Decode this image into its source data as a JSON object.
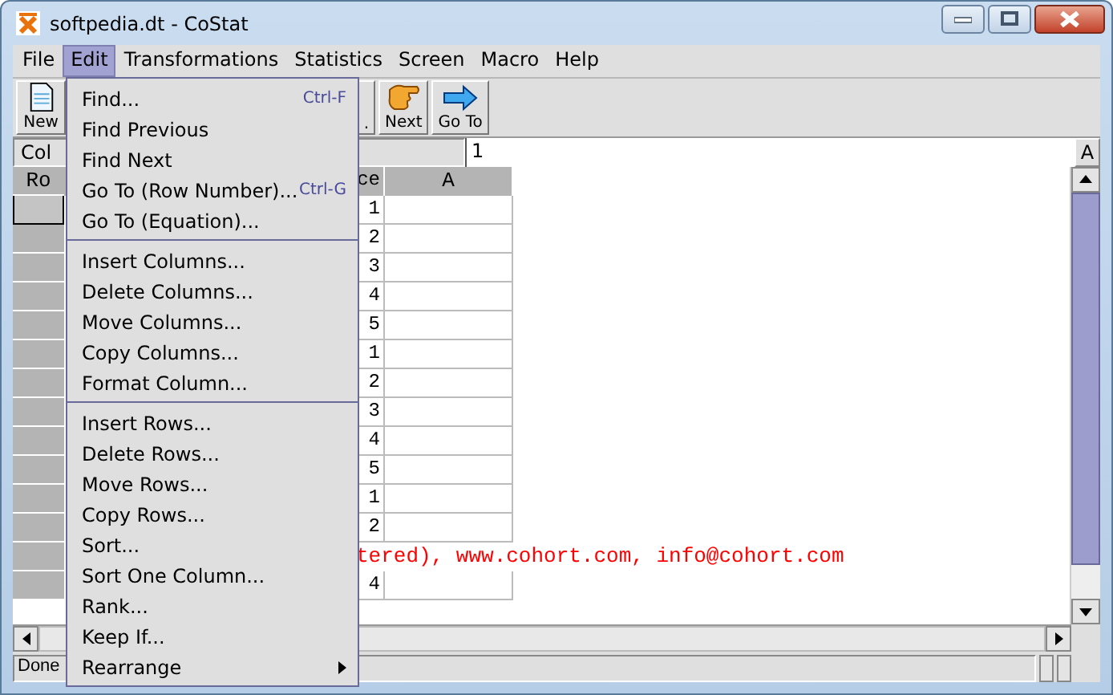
{
  "window": {
    "title": "softpedia.dt - CoStat"
  },
  "menubar": [
    {
      "label": "File",
      "selected": false
    },
    {
      "label": "Edit",
      "selected": true
    },
    {
      "label": "Transformations",
      "selected": false
    },
    {
      "label": "Statistics",
      "selected": false
    },
    {
      "label": "Screen",
      "selected": false
    },
    {
      "label": "Macro",
      "selected": false
    },
    {
      "label": "Help",
      "selected": false
    }
  ],
  "toolbar": [
    {
      "label": "New",
      "kind": "new"
    },
    {
      "label": ".",
      "kind": "partial"
    },
    {
      "label": "Next",
      "kind": "next"
    },
    {
      "label": "Go To",
      "kind": "goto"
    }
  ],
  "cell_bar": {
    "name": "Col",
    "value": "1",
    "button": "A"
  },
  "table": {
    "columns": [
      "Ro",
      "ce",
      "A"
    ],
    "rows": [
      {
        "kind": "data",
        "value": "1",
        "selected": true
      },
      {
        "kind": "data",
        "value": "2",
        "selected": false
      },
      {
        "kind": "data",
        "value": "3",
        "selected": false
      },
      {
        "kind": "data",
        "value": "4",
        "selected": false
      },
      {
        "kind": "data",
        "value": "5",
        "selected": false
      },
      {
        "kind": "data",
        "value": "1",
        "selected": false
      },
      {
        "kind": "data",
        "value": "2",
        "selected": false
      },
      {
        "kind": "data",
        "value": "3",
        "selected": false
      },
      {
        "kind": "data",
        "value": "4",
        "selected": false
      },
      {
        "kind": "data",
        "value": "5",
        "selected": false
      },
      {
        "kind": "data",
        "value": "1",
        "selected": false
      },
      {
        "kind": "data",
        "value": "2",
        "selected": false
      },
      {
        "kind": "note",
        "value": "tered), www.cohort.com, info@cohort.com",
        "selected": false
      },
      {
        "kind": "data",
        "value": "4",
        "selected": false
      }
    ]
  },
  "status_bar": {
    "text": "Done"
  },
  "edit_menu": [
    {
      "kind": "item",
      "label": "Find...",
      "shortcut": "Ctrl-F"
    },
    {
      "kind": "item",
      "label": "Find Previous"
    },
    {
      "kind": "item",
      "label": "Find Next"
    },
    {
      "kind": "item",
      "label": "Go To (Row Number)...",
      "shortcut": "Ctrl-G"
    },
    {
      "kind": "item",
      "label": "Go To (Equation)..."
    },
    {
      "kind": "separator"
    },
    {
      "kind": "item",
      "label": "Insert Columns..."
    },
    {
      "kind": "item",
      "label": "Delete Columns..."
    },
    {
      "kind": "item",
      "label": "Move Columns..."
    },
    {
      "kind": "item",
      "label": "Copy Columns..."
    },
    {
      "kind": "item",
      "label": "Format Column..."
    },
    {
      "kind": "separator"
    },
    {
      "kind": "item",
      "label": "Insert Rows..."
    },
    {
      "kind": "item",
      "label": "Delete Rows..."
    },
    {
      "kind": "item",
      "label": "Move Rows..."
    },
    {
      "kind": "item",
      "label": "Copy Rows..."
    },
    {
      "kind": "item",
      "label": "Sort..."
    },
    {
      "kind": "item",
      "label": "Sort One Column..."
    },
    {
      "kind": "item",
      "label": "Rank..."
    },
    {
      "kind": "item",
      "label": "Keep If..."
    },
    {
      "kind": "submenu",
      "label": "Rearrange"
    }
  ]
}
